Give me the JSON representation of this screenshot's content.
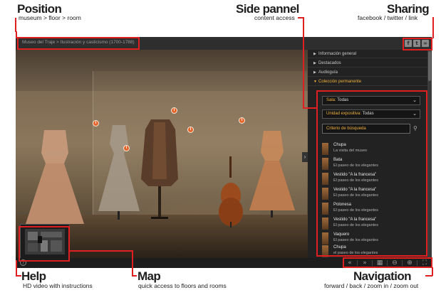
{
  "annotations": {
    "position": {
      "title": "Position",
      "subtitle": "museum > floor > room"
    },
    "side_panel": {
      "title": "Side pannel",
      "subtitle": "content access"
    },
    "sharing": {
      "title": "Sharing",
      "subtitle": "facebook / twitter / link"
    },
    "help": {
      "title": "Help",
      "subtitle": "HD video with instructions"
    },
    "map": {
      "title": "Map",
      "subtitle": "quick access to floors and rooms"
    },
    "navigation": {
      "title": "Navigation",
      "subtitle": "forward / back / zoom in / zoom out"
    }
  },
  "topbar": {
    "breadcrumb": "Museo del Traje > Ilustración y casticismo (1700-1788)",
    "share_buttons": [
      "facebook-icon",
      "twitter-icon",
      "link-icon"
    ]
  },
  "sidepanel": {
    "accordion": [
      {
        "label": "Información general",
        "active": false
      },
      {
        "label": "Destacados",
        "active": false
      },
      {
        "label": "Audioguía",
        "active": false
      },
      {
        "label": "Colección permanente",
        "active": true
      }
    ],
    "room_select": {
      "label": "Sala",
      "value": "Todas"
    },
    "unit_select": {
      "label": "Unidad expositiva",
      "value": "Todas"
    },
    "search_placeholder": "Criterio de búsqueda",
    "results": [
      {
        "title": "Chupa",
        "subtitle": "La visita del museo"
      },
      {
        "title": "Bata",
        "subtitle": "El paseo de los elegantes"
      },
      {
        "title": "Vestido \"A la francesa\"",
        "subtitle": "El paseo de los elegantes"
      },
      {
        "title": "Vestido \"A la francesa\"",
        "subtitle": "El paseo de los elegantes"
      },
      {
        "title": "Polonesa",
        "subtitle": "El paseo de los elegantes"
      },
      {
        "title": "Vestido \"A la francesa\"",
        "subtitle": "El paseo de los elegantes"
      },
      {
        "title": "Vaquero",
        "subtitle": "El paseo de los elegantes"
      },
      {
        "title": "Chupa",
        "subtitle": "el paseo de los elegantes"
      }
    ]
  },
  "navigation": {
    "buttons": [
      "back-icon",
      "forward-icon",
      "map-icon",
      "zoom-out-icon",
      "zoom-in-icon",
      "fullscreen-icon"
    ]
  },
  "colors": {
    "accent": "#f0b040",
    "annotation": "#e02020",
    "hotspot": "#e7642a"
  }
}
